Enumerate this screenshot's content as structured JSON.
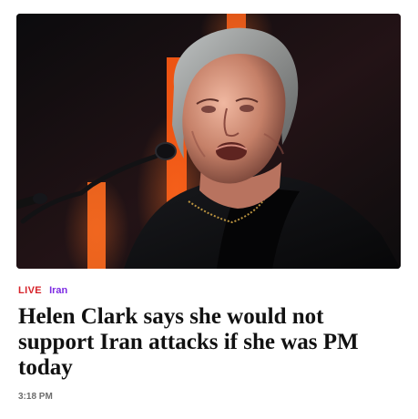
{
  "article": {
    "live_label": "LIVE",
    "topic": "Iran",
    "headline": "Helen Clark says she would not support Iran attacks if she was PM today",
    "time": "3:18 PM"
  },
  "image": {
    "subject": "photo-of-speaker-at-microphone"
  },
  "colors": {
    "live": "#d7232a",
    "topic": "#7d2be3",
    "headline": "#111111",
    "time": "#6d6d6d"
  }
}
